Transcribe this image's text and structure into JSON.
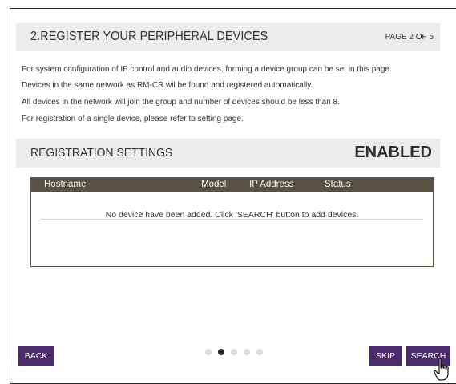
{
  "header": {
    "title": "2.REGISTER YOUR PERIPHERAL DEVICES",
    "page_counter": "PAGE 2 OF 5"
  },
  "description": {
    "lines": [
      "For system configuration of IP control and audio devices, forming a device group can be set in this page.",
      "Devices in the same network as RM-CR wil be found and registered automatically.",
      "All devices in the network will join the group and number of devices should be less than 8.",
      "For registration of a single device, please refer to setting page."
    ]
  },
  "registration": {
    "title": "REGISTRATION SETTINGS",
    "status": "ENABLED"
  },
  "device_table": {
    "columns": [
      "Hostname",
      "Model",
      "IP Address",
      "Status"
    ],
    "empty_message": "No device have been added. Click 'SEARCH' button to add devices."
  },
  "pagination": {
    "total": 5,
    "active_index": 1
  },
  "buttons": {
    "back": "BACK",
    "skip": "SKIP",
    "search": "SEARCH"
  },
  "colors": {
    "accent": "#4b2a6e",
    "table_header": "#575243",
    "section_bar": "#ececec"
  },
  "icons": {
    "cursor": "hand-pointer-icon"
  }
}
